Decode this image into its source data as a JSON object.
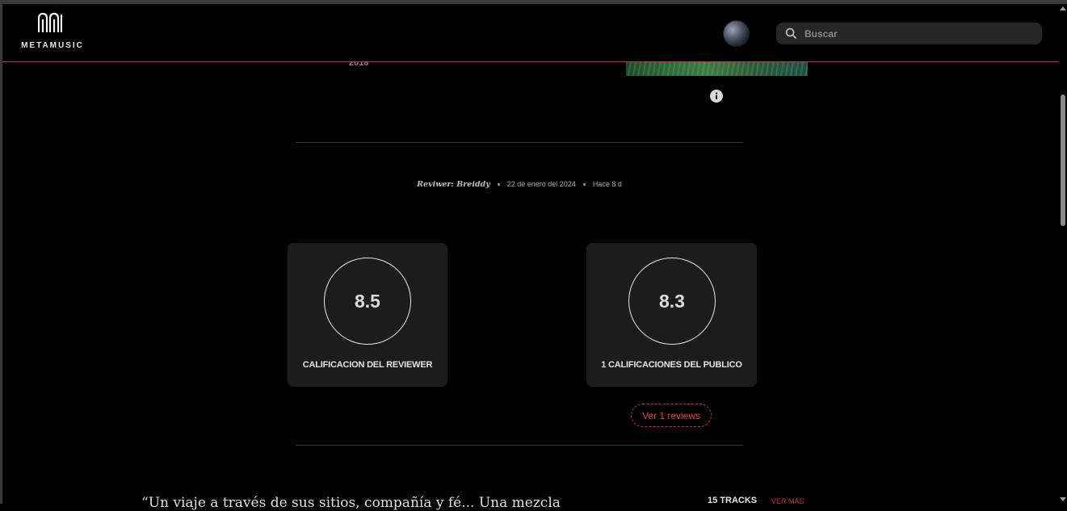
{
  "header": {
    "brand_name": "METAMUSIC",
    "search_placeholder": "Buscar"
  },
  "album": {
    "year": "2018"
  },
  "review_meta": {
    "reviewer": "Reviwer: Breiddy",
    "date": "22 de enero del 2024",
    "relative_time": "Hace 8 d"
  },
  "scores": {
    "reviewer": {
      "value": "8.5",
      "label": "CALIFICACION DEL REVIEWER"
    },
    "public": {
      "value": "8.3",
      "label": "1 CALIFICACIONES DEL PUBLICO"
    },
    "reviews_button": "Ver 1 reviews"
  },
  "review_text": {
    "quote_start": "“Un viaje a través de sus sitios, compañía y fé... Una mezcla"
  },
  "tracks": {
    "count_label": "15 TRACKS",
    "see_more": "VER MAS"
  },
  "colors": {
    "accent": "#c8324a",
    "background": "#000000",
    "card": "#1c1c1c",
    "search_bg": "#262626"
  }
}
